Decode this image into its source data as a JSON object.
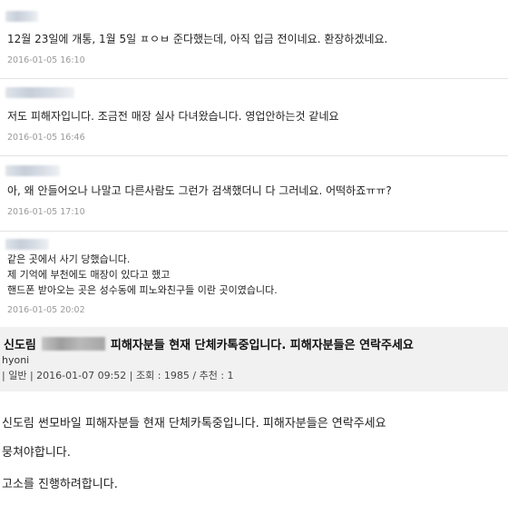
{
  "comments": [
    {
      "text": "12월 23일에 개통, 1월 5일 ㅍㅇㅂ 준다했는데, 아직 입금 전이네요. 환장하겠네요.",
      "date": "2016-01-05 16:10"
    },
    {
      "text": "저도 피해자입니다. 조금전 매장 실사 다녀왔습니다. 영업안하는것 같네요",
      "date": "2016-01-05 16:46"
    },
    {
      "text": "아, 왜 안들어오나 나말고 다른사람도 그런가 검색했더니 다 그러네요. 어떡하죠ㅠㅠ?",
      "date": "2016-01-05 17:10"
    },
    {
      "lines": [
        "같은 곳에서 사기 당했습니다.",
        "제 기억에 부천에도 매장이 있다고 했고",
        "핸드폰 받아오는 곳은 성수동에 피노와친구들 이란 곳이였습니다."
      ],
      "date": "2016-01-05 20:02"
    }
  ],
  "post": {
    "title_prefix": "신도림",
    "title_suffix": "피해자분들 현재 단체카톡중입니다. 피해자분들은 연락주세요",
    "author": "hyoni",
    "meta": "| 일반 | 2016-01-07 09:52 | 조회 : 1985 / 추천 : 1",
    "body": [
      "신도림 썬모바일 피해자분들 현재 단체카톡중입니다. 피해자분들은 연락주세요",
      "뭉쳐야합니다.",
      "고소를 진행하려합니다."
    ]
  }
}
